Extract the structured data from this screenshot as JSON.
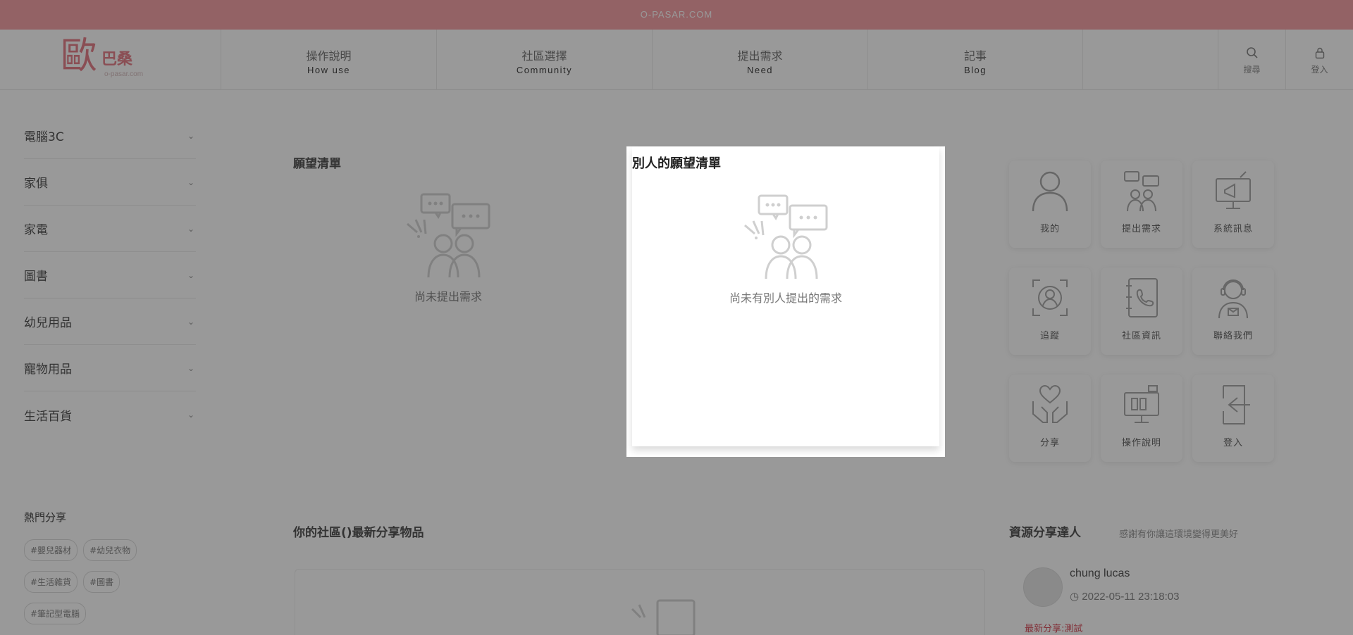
{
  "topbar": {
    "site": "O-PASAR.COM"
  },
  "logo": {
    "main": "歐",
    "sub": "巴桑",
    "url": "o-pasar.com"
  },
  "nav": [
    {
      "zh": "操作說明",
      "en": "How use"
    },
    {
      "zh": "社區選擇",
      "en": "Community"
    },
    {
      "zh": "提出需求",
      "en": "Need"
    },
    {
      "zh": "記事",
      "en": "Blog"
    }
  ],
  "header_buttons": {
    "search": "搜尋",
    "login": "登入"
  },
  "sidebar": {
    "categories": [
      "電腦3C",
      "家俱",
      "家電",
      "圖書",
      "幼兒用品",
      "寵物用品",
      "生活百貨"
    ]
  },
  "hot": {
    "title": "熱門分享",
    "tags": [
      "#嬰兒器材",
      "#幼兒衣物",
      "#生活雜貨",
      "#圖書",
      "#筆記型電腦"
    ]
  },
  "wishlist": {
    "title": "願望清單",
    "empty_text": "尚未提出需求"
  },
  "quick_links": [
    {
      "label": "我的",
      "icon": "user-icon"
    },
    {
      "label": "提出需求",
      "icon": "chat-people-icon"
    },
    {
      "label": "系統訊息",
      "icon": "megaphone-icon"
    },
    {
      "label": "追蹤",
      "icon": "target-user-icon"
    },
    {
      "label": "社區資訊",
      "icon": "phone-book-icon"
    },
    {
      "label": "聯絡我們",
      "icon": "support-icon"
    },
    {
      "label": "分享",
      "icon": "heart-hands-icon"
    },
    {
      "label": "操作說明",
      "icon": "monitor-icon"
    },
    {
      "label": "登入",
      "icon": "login-icon"
    }
  ],
  "feed": {
    "title": "你的社區()最新分享物品"
  },
  "sharers": {
    "title": "資源分享達人",
    "subtitle": "感謝有你讓這環境變得更美好",
    "top": {
      "name": "chung lucas",
      "time": "2022-05-11 23:18:03",
      "latest": "最新分享:測試"
    }
  },
  "modal": {
    "title": "別人的願望清單",
    "empty_text": "尚未有別人提出的需求"
  },
  "colors": {
    "brand": "#f6a3a9",
    "logo": "#e7838c",
    "overlay": "rgba(0,0,0,0.4)"
  }
}
